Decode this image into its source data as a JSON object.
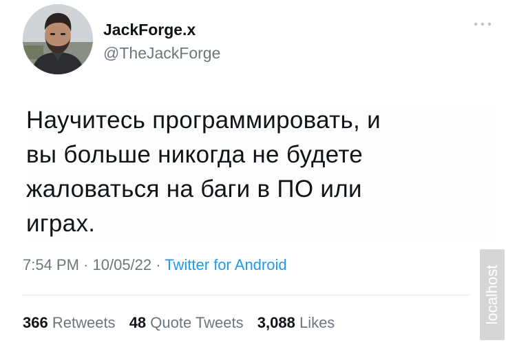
{
  "author": {
    "display_name": "JackForge.x",
    "handle": "@TheJackForge"
  },
  "tweet": {
    "lines": [
      "Научитесь программировать, и",
      "вы больше никогда не будете",
      "жаловаться на баги в ПО или",
      "играх."
    ],
    "time": "7:54 PM",
    "date": "10/05/22",
    "separator": " · ",
    "source": "Twitter for Android"
  },
  "stats": {
    "retweets_count": "366",
    "retweets_label": "Retweets",
    "quotes_count": "48",
    "quotes_label": "Quote Tweets",
    "likes_count": "3,088",
    "likes_label": "Likes"
  },
  "watermark": {
    "text": "localhost"
  },
  "icons": {
    "more": "more-horizontal-icon"
  },
  "colors": {
    "text": "#0f1419",
    "secondary": "#6b7680",
    "link": "#1d9bf0"
  }
}
